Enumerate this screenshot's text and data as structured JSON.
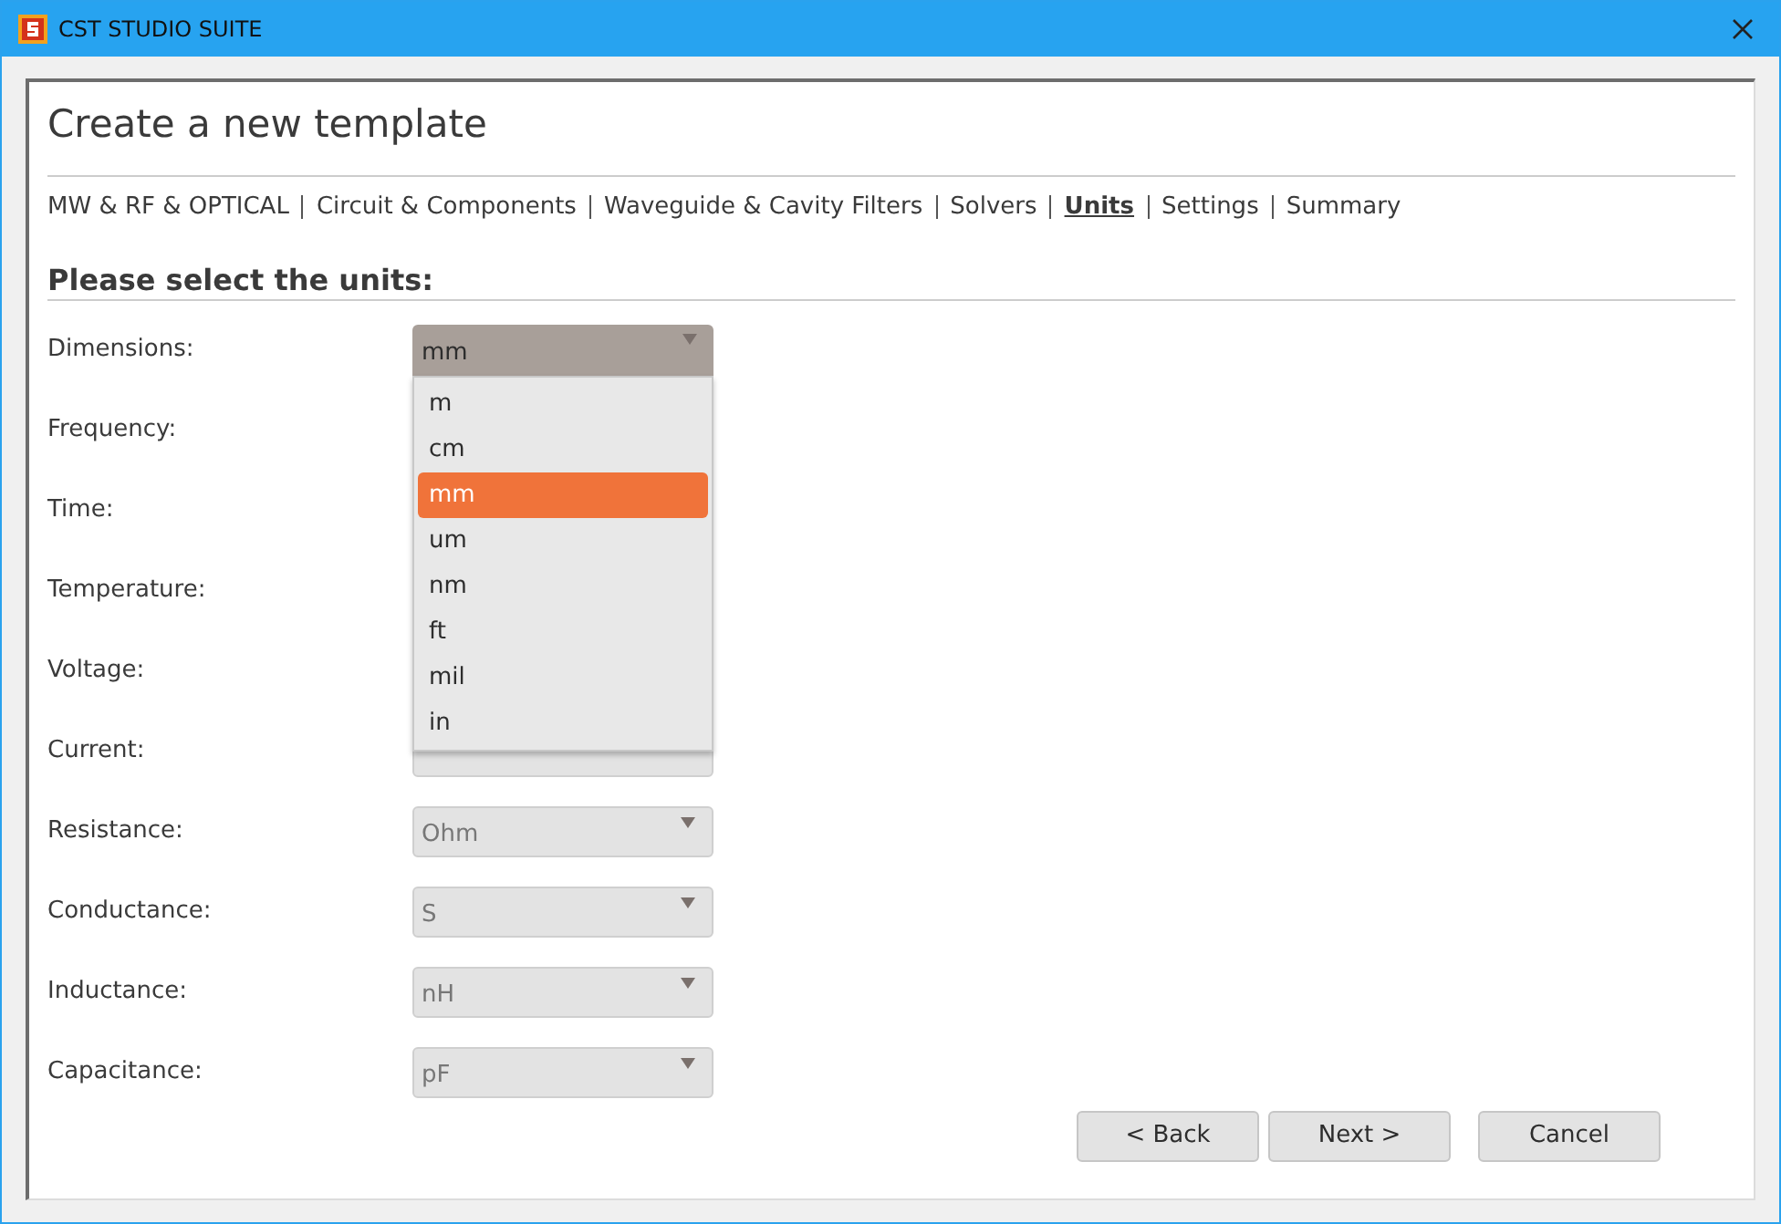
{
  "window": {
    "title": "CST STUDIO SUITE"
  },
  "heading": "Create a new template",
  "steps": [
    {
      "label": "MW & RF & OPTICAL",
      "selected": false
    },
    {
      "label": "Circuit & Components",
      "selected": false
    },
    {
      "label": "Waveguide & Cavity Filters",
      "selected": false
    },
    {
      "label": "Solvers",
      "selected": false
    },
    {
      "label": "Units",
      "selected": true
    },
    {
      "label": "Settings",
      "selected": false
    },
    {
      "label": "Summary",
      "selected": false
    }
  ],
  "section_title": "Please select the units:",
  "units": [
    {
      "label": "Dimensions:",
      "value": "mm",
      "expanded": true,
      "options": [
        {
          "label": "m",
          "selected": false
        },
        {
          "label": "cm",
          "selected": false
        },
        {
          "label": "mm",
          "selected": true
        },
        {
          "label": "um",
          "selected": false
        },
        {
          "label": "nm",
          "selected": false
        },
        {
          "label": "ft",
          "selected": false
        },
        {
          "label": "mil",
          "selected": false
        },
        {
          "label": "in",
          "selected": false
        }
      ]
    },
    {
      "label": "Frequency:"
    },
    {
      "label": "Time:"
    },
    {
      "label": "Temperature:"
    },
    {
      "label": "Voltage:"
    },
    {
      "label": "Current:",
      "expanded": false
    },
    {
      "label": "Resistance:",
      "value": "Ohm",
      "expanded": false
    },
    {
      "label": "Conductance:",
      "value": "S",
      "expanded": false
    },
    {
      "label": "Inductance:",
      "value": "nH",
      "expanded": false
    },
    {
      "label": "Capacitance:",
      "value": "pF",
      "expanded": false
    }
  ],
  "buttons": [
    "< Back",
    "Next >",
    "Cancel"
  ]
}
